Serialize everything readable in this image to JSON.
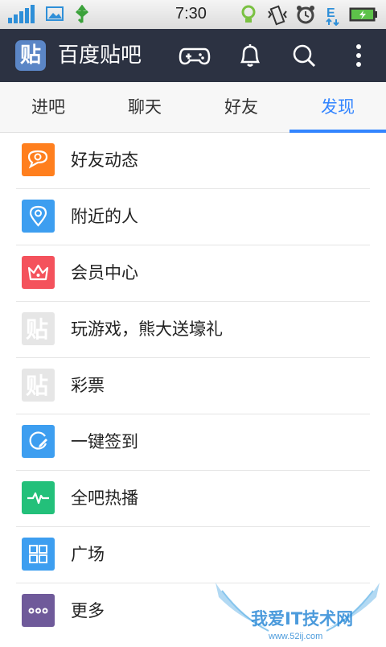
{
  "status_bar": {
    "time": "7:30"
  },
  "app_bar": {
    "logo": "贴",
    "title": "百度贴吧",
    "icons": [
      "gamepad-icon",
      "bell-icon",
      "search-icon",
      "more-vertical-icon"
    ]
  },
  "tabs": [
    {
      "label": "进吧",
      "active": false
    },
    {
      "label": "聊天",
      "active": false
    },
    {
      "label": "好友",
      "active": false
    },
    {
      "label": "发现",
      "active": true
    }
  ],
  "menu": [
    {
      "label": "好友动态",
      "icon": "friend-feed-icon",
      "color": "#ff7f1e"
    },
    {
      "label": "附近的人",
      "icon": "location-pin-icon",
      "color": "#3d9ef0"
    },
    {
      "label": "会员中心",
      "icon": "crown-icon",
      "color": "#f4525c"
    },
    {
      "label": "玩游戏，熊大送壕礼",
      "icon": "tieba-logo-icon",
      "color": "#e6e6e6"
    },
    {
      "label": "彩票",
      "icon": "tieba-logo-icon",
      "color": "#e6e6e6"
    },
    {
      "label": "一键签到",
      "icon": "sign-in-icon",
      "color": "#3d9ef0"
    },
    {
      "label": "全吧热播",
      "icon": "pulse-icon",
      "color": "#23c07a"
    },
    {
      "label": "广场",
      "icon": "grid-icon",
      "color": "#3d9ef0"
    },
    {
      "label": "更多",
      "icon": "more-icon",
      "color": "#6f5a9a"
    }
  ],
  "watermark": {
    "text": "我爱IT技术网",
    "url": "www.52ij.com"
  }
}
